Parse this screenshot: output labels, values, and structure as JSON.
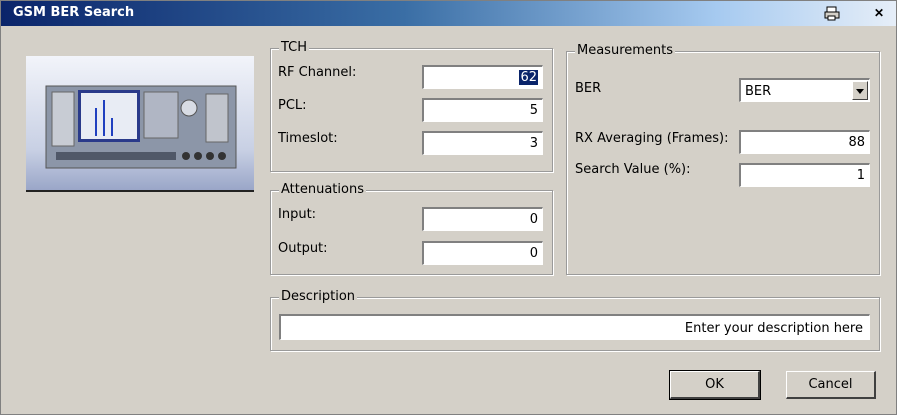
{
  "window": {
    "title": "GSM BER Search"
  },
  "tch": {
    "legend": "TCH",
    "rf_channel": {
      "label": "RF Channel:",
      "value": "62"
    },
    "pcl": {
      "label": "PCL:",
      "value": "5"
    },
    "timeslot": {
      "label": "Timeslot:",
      "value": "3"
    }
  },
  "attenuations": {
    "legend": "Attenuations",
    "input": {
      "label": "Input:",
      "value": "0"
    },
    "output": {
      "label": "Output:",
      "value": "0"
    }
  },
  "measurements": {
    "legend": "Measurements",
    "ber": {
      "label": "BER",
      "selected": "BER"
    },
    "rx_averaging": {
      "label": "RX Averaging (Frames):",
      "value": "88"
    },
    "search_value": {
      "label": "Search Value (%):",
      "value": "1"
    }
  },
  "description": {
    "legend": "Description",
    "value": "Enter your description here"
  },
  "buttons": {
    "ok": "OK",
    "cancel": "Cancel"
  },
  "icons": {
    "print": "print-icon",
    "close": "close-icon"
  }
}
